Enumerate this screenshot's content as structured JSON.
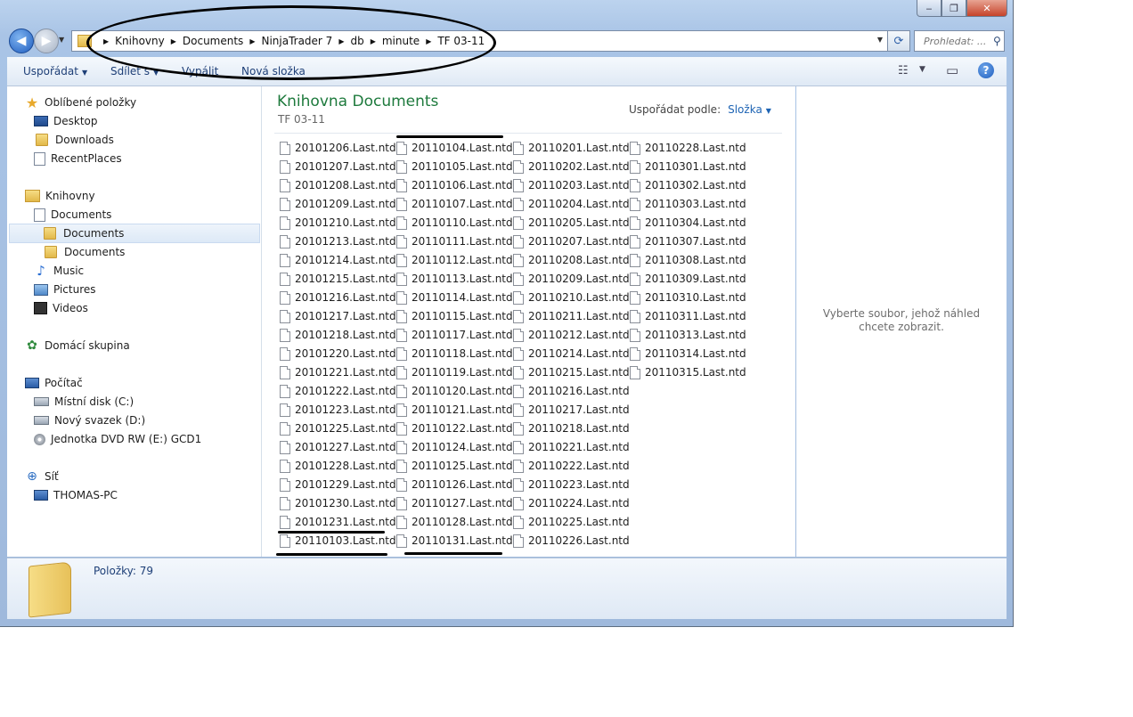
{
  "window": {
    "buttons": {
      "minimize": "‒",
      "maximize": "❐",
      "close": "✕"
    }
  },
  "address_bar": {
    "breadcrumb": [
      "Knihovny",
      "Documents",
      "NinjaTrader 7",
      "db",
      "minute",
      "TF 03-11"
    ],
    "search_placeholder": "Prohledat: ..."
  },
  "toolbar": {
    "organize": "Uspořádat",
    "share": "Sdílet s",
    "burn": "Vypálit",
    "new_folder": "Nová složka",
    "help": "?"
  },
  "nav": {
    "favorites": "Oblíbené položky",
    "desktop": "Desktop",
    "downloads": "Downloads",
    "recent": "RecentPlaces",
    "libraries": "Knihovny",
    "documents": "Documents",
    "documents_sub1": "Documents",
    "documents_sub2": "Documents",
    "music": "Music",
    "pictures": "Pictures",
    "videos": "Videos",
    "homegroup": "Domácí skupina",
    "computer": "Počítač",
    "disk_c": "Místní disk (C:)",
    "disk_d": "Nový svazek (D:)",
    "dvd": "Jednotka DVD RW (E:) GCD1",
    "network": "Síť",
    "pc": "THOMAS-PC"
  },
  "main": {
    "title": "Knihovna Documents",
    "subtitle": "TF 03-11",
    "arrange_label": "Uspořádat podle:",
    "arrange_value": "Složka"
  },
  "files": [
    [
      "20101206.Last.ntd",
      "20101207.Last.ntd",
      "20101208.Last.ntd",
      "20101209.Last.ntd",
      "20101210.Last.ntd",
      "20101213.Last.ntd",
      "20101214.Last.ntd",
      "20101215.Last.ntd",
      "20101216.Last.ntd",
      "20101217.Last.ntd",
      "20101218.Last.ntd",
      "20101220.Last.ntd",
      "20101221.Last.ntd",
      "20101222.Last.ntd",
      "20101223.Last.ntd",
      "20101225.Last.ntd",
      "20101227.Last.ntd",
      "20101228.Last.ntd",
      "20101229.Last.ntd",
      "20101230.Last.ntd",
      "20101231.Last.ntd",
      "20110103.Last.ntd"
    ],
    [
      "20110104.Last.ntd",
      "20110105.Last.ntd",
      "20110106.Last.ntd",
      "20110107.Last.ntd",
      "20110110.Last.ntd",
      "20110111.Last.ntd",
      "20110112.Last.ntd",
      "20110113.Last.ntd",
      "20110114.Last.ntd",
      "20110115.Last.ntd",
      "20110117.Last.ntd",
      "20110118.Last.ntd",
      "20110119.Last.ntd",
      "20110120.Last.ntd",
      "20110121.Last.ntd",
      "20110122.Last.ntd",
      "20110124.Last.ntd",
      "20110125.Last.ntd",
      "20110126.Last.ntd",
      "20110127.Last.ntd",
      "20110128.Last.ntd",
      "20110131.Last.ntd"
    ],
    [
      "20110201.Last.ntd",
      "20110202.Last.ntd",
      "20110203.Last.ntd",
      "20110204.Last.ntd",
      "20110205.Last.ntd",
      "20110207.Last.ntd",
      "20110208.Last.ntd",
      "20110209.Last.ntd",
      "20110210.Last.ntd",
      "20110211.Last.ntd",
      "20110212.Last.ntd",
      "20110214.Last.ntd",
      "20110215.Last.ntd",
      "20110216.Last.ntd",
      "20110217.Last.ntd",
      "20110218.Last.ntd",
      "20110221.Last.ntd",
      "20110222.Last.ntd",
      "20110223.Last.ntd",
      "20110224.Last.ntd",
      "20110225.Last.ntd",
      "20110226.Last.ntd"
    ],
    [
      "20110228.Last.ntd",
      "20110301.Last.ntd",
      "20110302.Last.ntd",
      "20110303.Last.ntd",
      "20110304.Last.ntd",
      "20110307.Last.ntd",
      "20110308.Last.ntd",
      "20110309.Last.ntd",
      "20110310.Last.ntd",
      "20110311.Last.ntd",
      "20110313.Last.ntd",
      "20110314.Last.ntd",
      "20110315.Last.ntd"
    ]
  ],
  "preview": {
    "message": "Vyberte soubor, jehož náhled chcete zobrazit."
  },
  "details": {
    "count": "Položky: 79"
  }
}
